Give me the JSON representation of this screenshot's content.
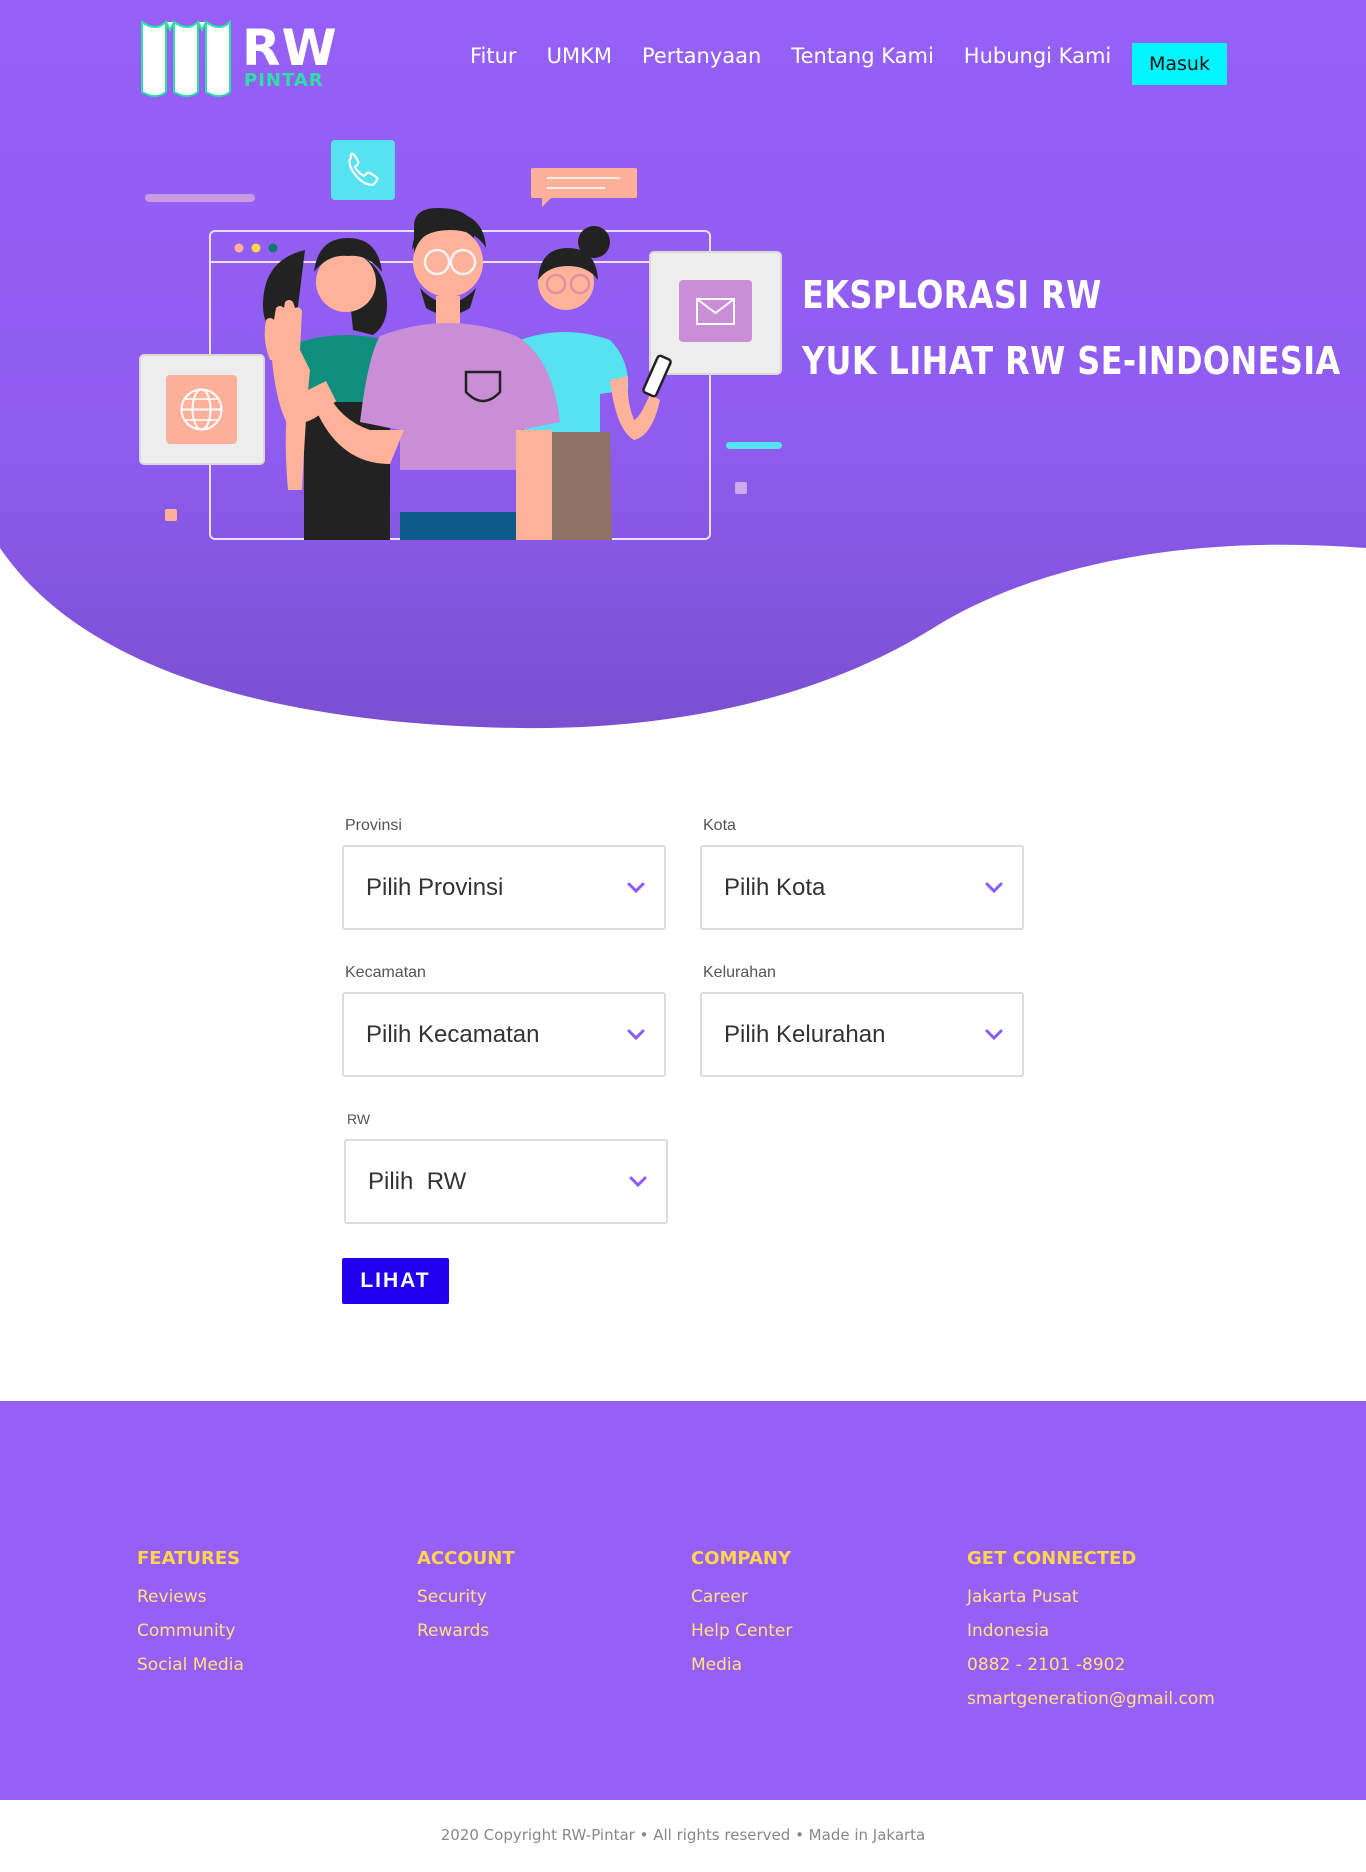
{
  "brand": {
    "logo_rw": "RW",
    "logo_pintar": "PINTAR"
  },
  "nav": {
    "items": [
      "Fitur",
      "UMKM",
      "Pertanyaan",
      "Tentang Kami",
      "Hubungi Kami"
    ],
    "login_label": "Masuk"
  },
  "hero": {
    "title_line1": "EKSPLORASI RW",
    "title_line2": "YUK LIHAT RW SE-INDONESIA"
  },
  "form": {
    "provinsi": {
      "label": "Provinsi",
      "value": "Pilih Provinsi"
    },
    "kota": {
      "label": "Kota",
      "value": "Pilih Kota"
    },
    "kecamatan": {
      "label": "Kecamatan",
      "value": "Pilih Kecamatan"
    },
    "kelurahan": {
      "label": "Kelurahan",
      "value": "Pilih Kelurahan"
    },
    "rw": {
      "label": "RW",
      "value": "Pilih  RW"
    },
    "submit_label": "LIHAT"
  },
  "footer": {
    "columns": [
      {
        "title": "FEATURES",
        "links": [
          "Reviews",
          "Community",
          "Social Media"
        ]
      },
      {
        "title": "ACCOUNT",
        "links": [
          "Security",
          "Rewards"
        ]
      },
      {
        "title": "COMPANY",
        "links": [
          "Career",
          "Help Center",
          "Media"
        ]
      },
      {
        "title": "GET CONNECTED",
        "links": [
          "Jakarta Pusat",
          "Indonesia",
          "0882 - 2101 -8902",
          "smartgeneration@gmail.com"
        ]
      }
    ],
    "copyright": "2020 Copyright RW-Pintar • All rights reserved • Made in Jakarta"
  },
  "colors": {
    "primary_purple": "#9660f6",
    "hero_gradient_bottom": "#7a4fd0",
    "login_button": "#00f5ff",
    "submit_button": "#2200ee",
    "footer_heading": "#ffd54f",
    "chevron": "#8a5cf0"
  },
  "icons": [
    "phone-icon",
    "chat-bubble-icon",
    "mail-icon",
    "globe-icon",
    "chevron-down-icon"
  ]
}
